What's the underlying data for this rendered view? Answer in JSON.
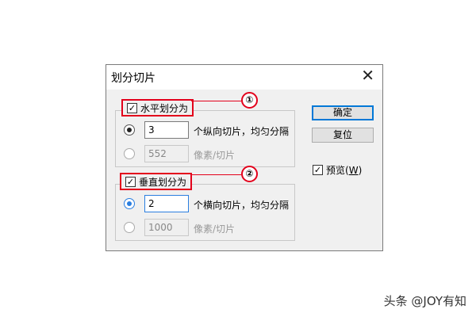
{
  "dialog": {
    "title": "划分切片",
    "close_glyph": "✕"
  },
  "horizontal": {
    "label": "水平划分为",
    "checked": true,
    "count_value": "3",
    "count_suffix": "个纵向切片，均匀分隔",
    "pixels_value": "552",
    "pixels_suffix": "像素/切片"
  },
  "vertical": {
    "label": "垂直划分为",
    "checked": true,
    "count_value": "2",
    "count_suffix": "个横向切片，均匀分隔",
    "pixels_value": "1000",
    "pixels_suffix": "像素/切片"
  },
  "buttons": {
    "ok": "确定",
    "reset": "复位"
  },
  "preview": {
    "label_prefix": "预览(",
    "label_key": "W",
    "label_suffix": ")",
    "checked": true
  },
  "annotations": {
    "marker1": "①",
    "marker2": "②"
  },
  "watermark": "头条 @JOY有知",
  "colors": {
    "annotation_red": "#e3001b",
    "focus_blue": "#2a7ee0",
    "default_button_blue": "#0078d7"
  }
}
